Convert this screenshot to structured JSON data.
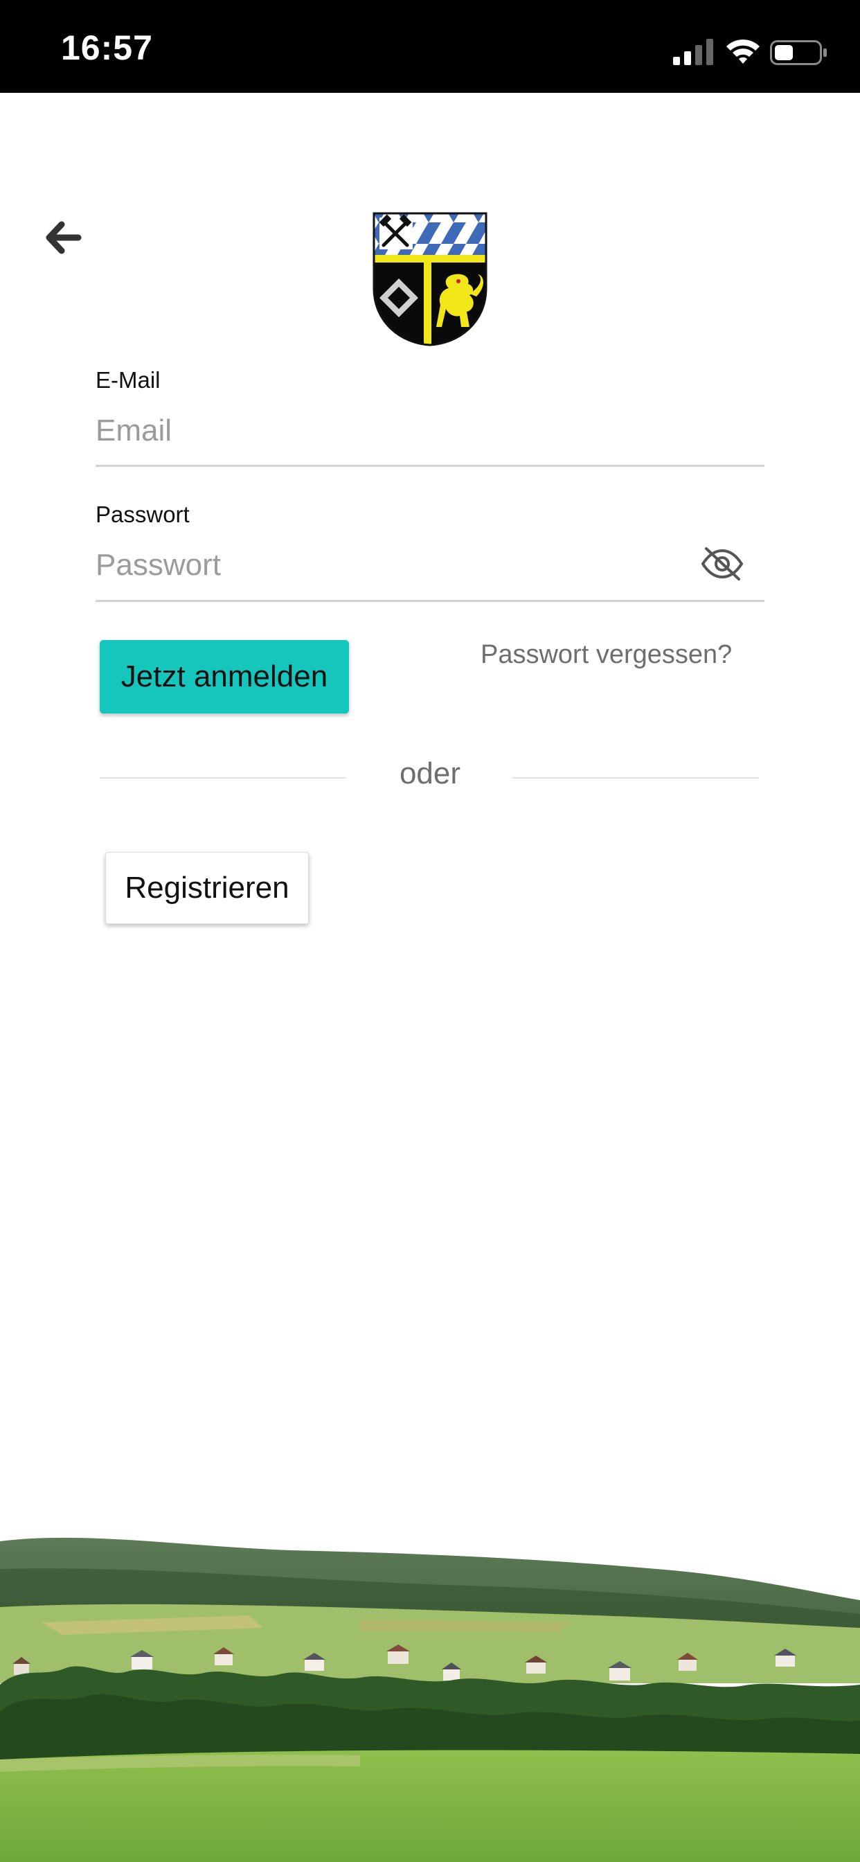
{
  "status_bar": {
    "time": "16:57",
    "icons": [
      "signal-icon",
      "wifi-icon",
      "battery-icon"
    ]
  },
  "header": {
    "back_icon": "arrow-left-icon",
    "logo": "municipal-coat-of-arms"
  },
  "form": {
    "email": {
      "label": "E-Mail",
      "placeholder": "Email",
      "value": ""
    },
    "password": {
      "label": "Passwort",
      "placeholder": "Passwort",
      "value": "",
      "toggle_icon": "eye-off-icon"
    },
    "login_label": "Jetzt anmelden",
    "forgot_label": "Passwort vergessen?",
    "divider_label": "oder",
    "register_label": "Registrieren"
  },
  "colors": {
    "primary": "#14c6bc",
    "status_bar_bg": "#000000",
    "placeholder": "#9b9b9b",
    "muted_text": "#6e6e6e"
  }
}
